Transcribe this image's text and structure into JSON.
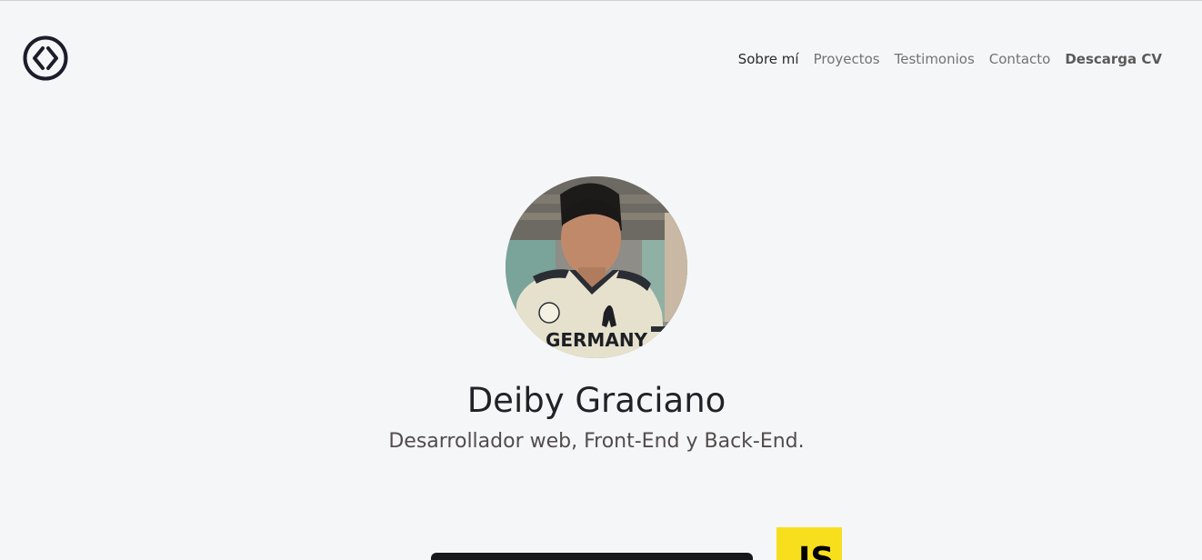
{
  "header": {
    "logo_icon": "code-brackets-circle-icon",
    "nav": {
      "about": "Sobre mí",
      "projects": "Proyectos",
      "testimonials": "Testimonios",
      "contact": "Contacto",
      "download_cv": "Descarga CV"
    }
  },
  "hero": {
    "avatar_alt": "Deiby Graciano",
    "name": "Deiby Graciano",
    "role": "Desarrollador web, Front-End y Back-End."
  },
  "skills": {
    "js_badge": "JS"
  },
  "colors": {
    "background": "#f5f6f8",
    "js_yellow": "#f7df1e"
  }
}
